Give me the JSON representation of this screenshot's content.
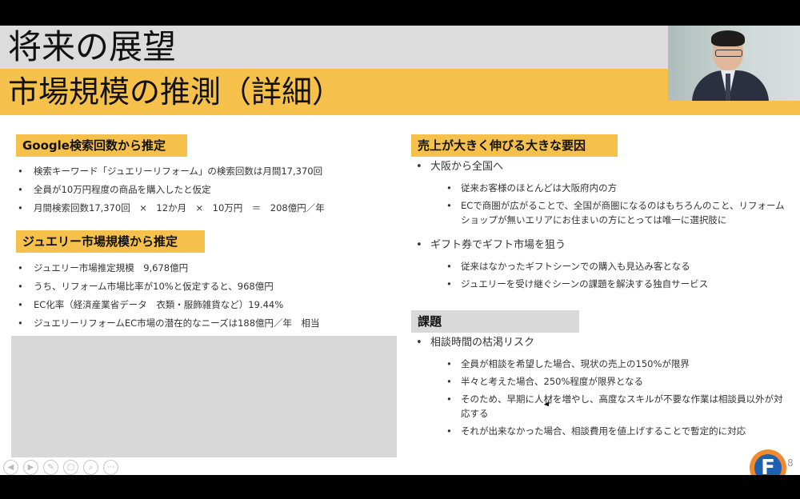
{
  "slide": {
    "title": "将来の展望",
    "subtitle": "市場規模の推測（詳細）",
    "page_number": "8"
  },
  "left": {
    "section1": {
      "heading": "Google検索回数から推定",
      "items": [
        "検索キーワード「ジュエリーリフォーム」の検索回数は月間17,370回",
        "全員が10万円程度の商品を購入したと仮定",
        "月間検索回数17,370回　×　12か月　×　10万円　＝　208億円／年"
      ]
    },
    "section2": {
      "heading": "ジュエリー市場規模から推定",
      "items": [
        "ジュエリー市場推定規模　9,678億円",
        "うち、リフォーム市場比率が10%と仮定すると、968億円",
        "EC化率（経済産業省データ　衣類・服飾雑貨など）19.44%",
        "ジュエリーリフォームEC市場の潜在的なニーズは188億円／年　相当"
      ]
    }
  },
  "right": {
    "section1": {
      "heading": "売上が大きく伸びる大きな要因",
      "groups": [
        {
          "label": "大阪から全国へ",
          "items": [
            "従来お客様のほとんどは大阪府内の方",
            "ECで商圏が広がることで、全国が商圏になるのはもちろんのこと、リフォームショップが無いエリアにお住まいの方にとっては唯一に選択肢に"
          ]
        },
        {
          "label": "ギフト券でギフト市場を狙う",
          "items": [
            "従来はなかったギフトシーンでの購入も見込み客となる",
            "ジュエリーを受け継ぐシーンの課題を解決する独自サービス"
          ]
        }
      ]
    },
    "section2": {
      "heading": "課題",
      "groups": [
        {
          "label": "相談時間の枯渇リスク",
          "items": [
            "全員が相談を希望した場合、現状の売上の150%が限界",
            "半々と考えた場合、250%程度が限界となる",
            "そのため、早期に人材を増やし、高度なスキルが不要な作業は相談員以外が対応する",
            "それが出来なかった場合、相談費用を値上げすることで暫定的に対応"
          ]
        }
      ]
    }
  },
  "toolbar": {
    "icons": [
      "prev-icon",
      "next-icon",
      "pen-icon",
      "copy-icon",
      "zoom-icon",
      "more-icon"
    ],
    "glyphs": [
      "◀",
      "▶",
      "✎",
      "▢",
      "⌕",
      "⋯"
    ]
  },
  "logo": {
    "letter": "F"
  },
  "colors": {
    "accent_yellow": "#f6c14a",
    "heading_gray": "#d9d9d9",
    "title_gray": "#dcdcdc"
  }
}
